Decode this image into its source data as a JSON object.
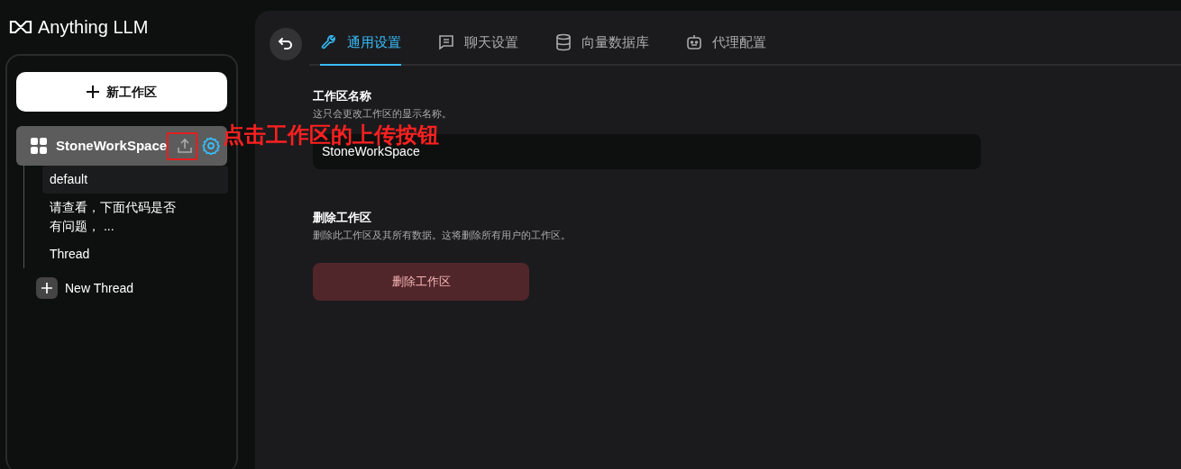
{
  "app": {
    "logo_text": "Anything LLM"
  },
  "sidebar": {
    "new_workspace_button": "新工作区",
    "workspace": {
      "name": "StoneWorkSpace",
      "selected": true
    },
    "threads": [
      {
        "label": "default",
        "selected": true
      },
      {
        "label": "请查看，下面代码是否有问题，  ...",
        "selected": false
      },
      {
        "label": "Thread",
        "selected": false
      }
    ],
    "new_thread_button": "New Thread"
  },
  "tabs": [
    {
      "label": "通用设置",
      "selected": true
    },
    {
      "label": "聊天设置",
      "selected": false
    },
    {
      "label": "向量数据库",
      "selected": false
    },
    {
      "label": "代理配置",
      "selected": false
    }
  ],
  "settings": {
    "name_section": {
      "title": "工作区名称",
      "description": "这只会更改工作区的显示名称。",
      "value": "StoneWorkSpace"
    },
    "delete_section": {
      "title": "删除工作区",
      "description": "删除此工作区及其所有数据。这将删除所有用户的工作区。",
      "button": "删除工作区"
    }
  },
  "annotation": {
    "text": "点击工作区的上传按钮"
  }
}
